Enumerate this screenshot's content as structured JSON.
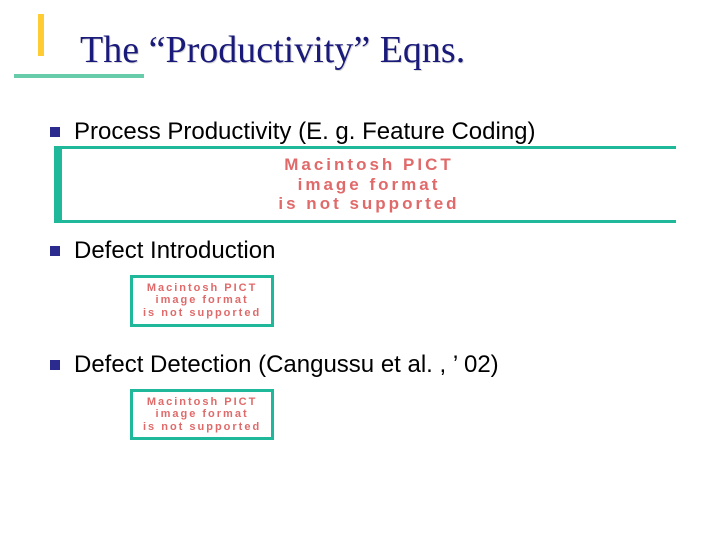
{
  "title": "The “Productivity” Eqns.",
  "bullets": [
    {
      "text": "Process Productivity (E. g. Feature Coding)"
    },
    {
      "text": "Defect Introduction"
    },
    {
      "text": "Defect Detection (Cangussu et al. , ’ 02)"
    }
  ],
  "pict_error": {
    "line1": "Macintosh PICT",
    "line2": "image format",
    "line3": "is not supported"
  }
}
